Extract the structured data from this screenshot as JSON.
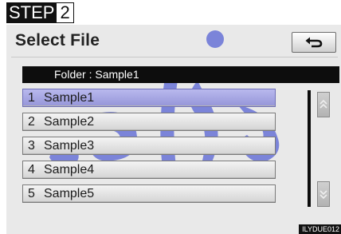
{
  "step": {
    "label": "STEP",
    "number": "2"
  },
  "header": {
    "title": "Select File"
  },
  "folder": {
    "label": "Folder : Sample1"
  },
  "files": [
    {
      "num": "1",
      "name": "Sample1",
      "selected": true
    },
    {
      "num": "2",
      "name": "Sample2",
      "selected": false
    },
    {
      "num": "3",
      "name": "Sample3",
      "selected": false
    },
    {
      "num": "4",
      "name": "Sample4",
      "selected": false
    },
    {
      "num": "5",
      "name": "Sample5",
      "selected": false
    }
  ],
  "icons": {
    "back": "back-arrow-icon",
    "scroll_up": "double-chevron-up-icon",
    "scroll_down": "double-chevron-down-icon"
  },
  "colors": {
    "selected_row": "#a5a5e0",
    "watermark": "#2233cc"
  },
  "code": "ILYDUE012"
}
